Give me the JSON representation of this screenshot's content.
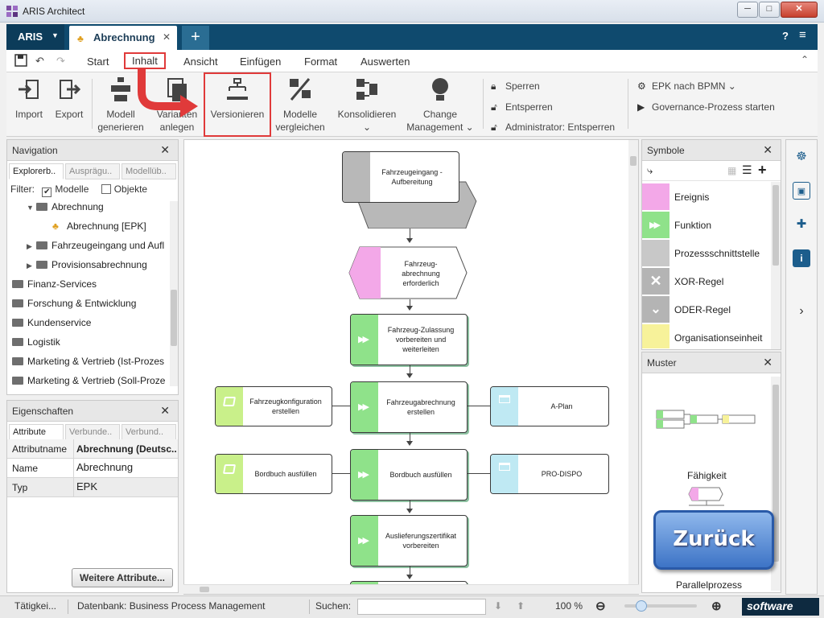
{
  "window": {
    "title": "ARIS Architect",
    "min": "─",
    "max": "□",
    "close": "✕"
  },
  "tabbar": {
    "aris_label": "ARIS",
    "doc_tab_label": "Abrechnung",
    "close": "✕",
    "new_tab": "+",
    "help": "?",
    "menu": "≡"
  },
  "ribbon_tabs": [
    "Start",
    "Inhalt",
    "Ansicht",
    "Einfügen",
    "Format",
    "Auswerten"
  ],
  "ribbon": {
    "import": "Import",
    "export": "Export",
    "modell_generieren_1": "Modell",
    "modell_generieren_2": "generieren",
    "varianten_1": "Varianten",
    "varianten_2": "anlegen",
    "versionieren": "Versionieren",
    "modelle_vergl_1": "Modelle",
    "modelle_vergl_2": "vergleichen",
    "konsolidieren": "Konsolidieren",
    "change_1": "Change",
    "change_2": "Management",
    "sperren": "Sperren",
    "entsperren": "Entsperren",
    "admin_entsperren": "Administrator: Entsperren",
    "epk_bpmn": "EPK nach BPMN",
    "governance": "Governance-Prozess starten"
  },
  "navigation": {
    "title": "Navigation",
    "tabs": [
      "Explorerb..",
      "Ausprägu..",
      "Modellüb.."
    ],
    "filter_label": "Filter:",
    "filter_modelle": "Modelle",
    "filter_objekte": "Objekte",
    "tree": [
      "Abrechnung",
      "Abrechnung [EPK]",
      "Fahrzeugeingang und Aufl",
      "Provisionsabrechnung",
      "Finanz-Services",
      "Forschung & Entwicklung",
      "Kundenservice",
      "Logistik",
      "Marketing & Vertrieb (Ist-Prozes",
      "Marketing & Vertrieb (Soll-Proze"
    ]
  },
  "properties": {
    "title": "Eigenschaften",
    "tabs": [
      "Attribute",
      "Verbunde..",
      "Verbund.."
    ],
    "header_key": "Attributname",
    "header_value": "Abrechnung (Deutsc...",
    "rows": [
      {
        "key": "Name",
        "value": "Abrechnung"
      },
      {
        "key": "Typ",
        "value": "EPK"
      }
    ],
    "more_button": "Weitere Attribute..."
  },
  "canvas": {
    "nodes": {
      "n1": "Fahrzeugeingang - Aufbereitung",
      "n2": "Fahrzeug-abrechnung erforderlich",
      "n3": "Fahrzeug-Zulassung vorbereiten und weiterleiten",
      "n4": "Fahrzeugabrechnung erstellen",
      "n4l": "Fahrzeugkonfiguration erstellen",
      "n4r": "A-Plan",
      "n5": "Bordbuch ausfüllen",
      "n5l": "Bordbuch ausfüllen",
      "n5r": "PRO-DISPO",
      "n6": "Auslieferungszertifikat vorbereiten"
    }
  },
  "symbols": {
    "title": "Symbole",
    "items": [
      {
        "label": "Ereignis",
        "color": "#f3a8e8"
      },
      {
        "label": "Funktion",
        "color": "#8fe28a"
      },
      {
        "label": "Prozessschnittstelle",
        "color": "#c8c8c8"
      },
      {
        "label": "XOR-Regel",
        "color": "#b4b4b4"
      },
      {
        "label": "ODER-Regel",
        "color": "#b4b4b4"
      },
      {
        "label": "Organisationseinheit",
        "color": "#f7f29a"
      }
    ]
  },
  "muster": {
    "title": "Muster",
    "item1": "Fähigkeit",
    "item2": "Parallelprozess"
  },
  "overlay": {
    "back_button": "Zurück"
  },
  "statusbar": {
    "activity": "Tätigkei...",
    "database": "Datenbank: Business Process Management",
    "search_label": "Suchen:",
    "zoom": "100 %",
    "brand": "software"
  }
}
